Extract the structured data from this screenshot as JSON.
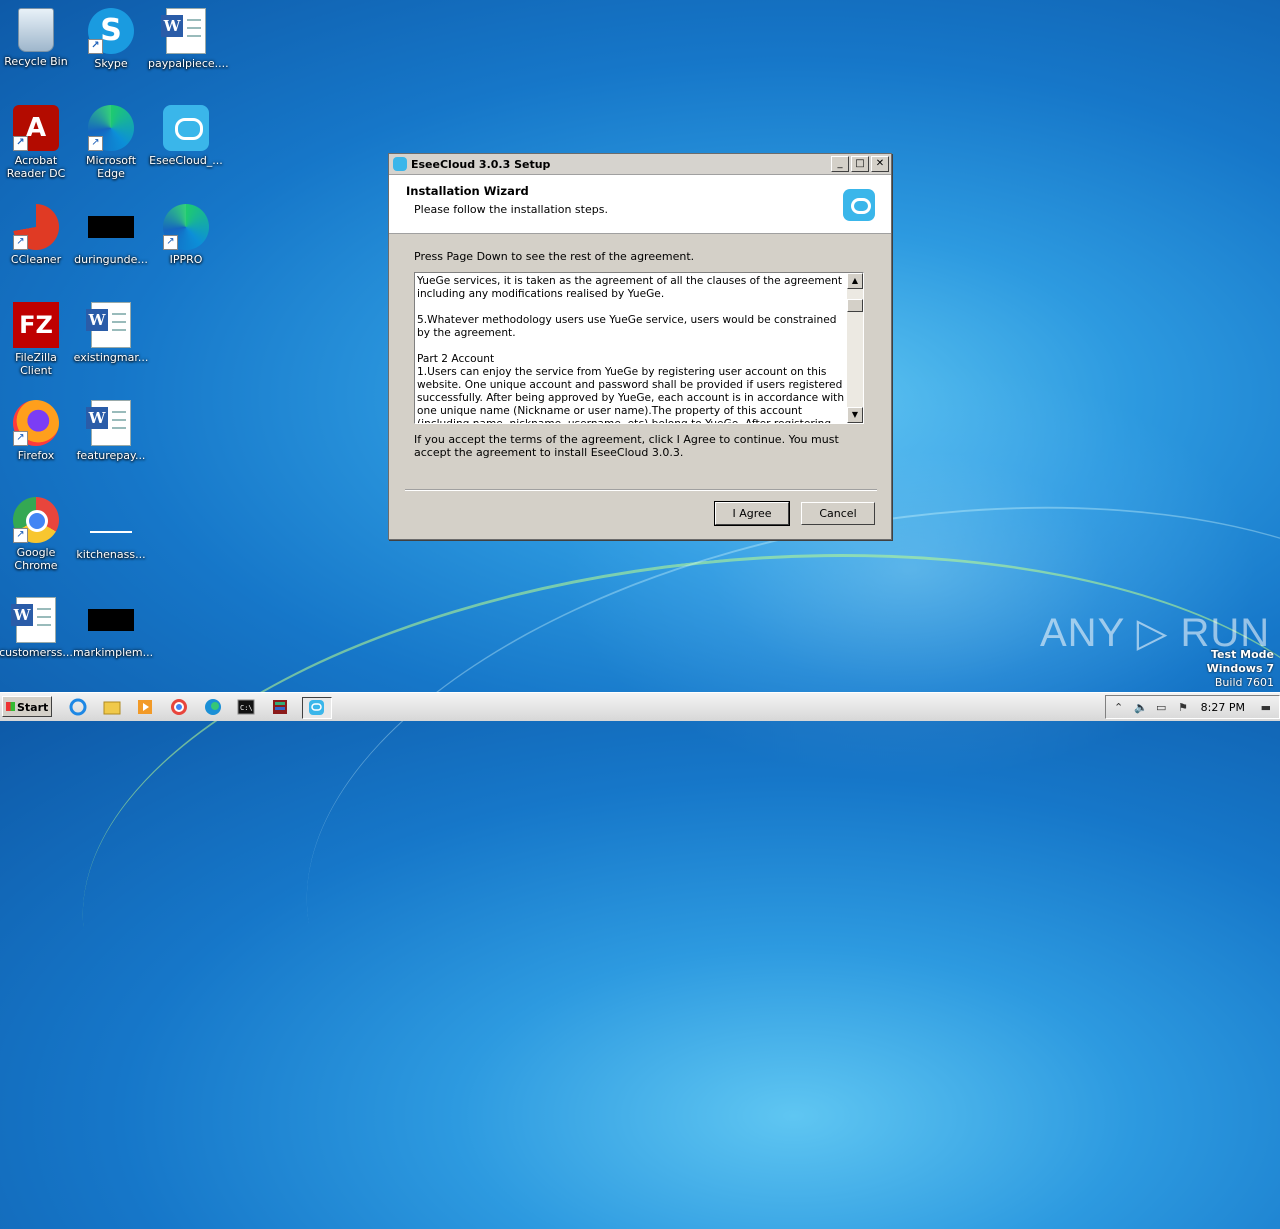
{
  "desktop": {
    "icons": [
      {
        "label": "Recycle Bin"
      },
      {
        "label": "Skype"
      },
      {
        "label": "paypalpiece...."
      },
      {
        "label": "Acrobat Reader DC"
      },
      {
        "label": "Microsoft Edge"
      },
      {
        "label": "EseeCloud_..."
      },
      {
        "label": "CCleaner"
      },
      {
        "label": "duringunde..."
      },
      {
        "label": "IPPRO"
      },
      {
        "label": "FileZilla Client"
      },
      {
        "label": "existingmar..."
      },
      {
        "label": "Firefox"
      },
      {
        "label": "featurepay..."
      },
      {
        "label": "Google Chrome"
      },
      {
        "label": "kitchenass..."
      },
      {
        "label": "customerss..."
      },
      {
        "label": "markimplem..."
      }
    ]
  },
  "window": {
    "title": "EseeCloud 3.0.3 Setup",
    "header_title": "Installation Wizard",
    "header_subtitle": "Please follow the installation steps.",
    "instruction": "Press Page Down to see the rest of the agreement.",
    "license_text": "YueGe services, it is taken as the agreement of all the clauses of the agreement including any modifications realised by YueGe.\n\n5.Whatever methodology users use YueGe service, users would be constrained by the agreement.\n\nPart 2 Account\n1.Users can enjoy the service from YueGe by registering user account on this website. One unique account and password shall be provided if users registered successfully. After being approved by YueGe, each account is in accordance with one unique name (Nickname or user name).The property of this account (including name, nickname, username, etc) belong to YueGe. After registering, users would be authorized to use this",
    "accept_note": "If you accept the terms of the agreement, click I Agree to continue. You must accept the agreement to install EseeCloud 3.0.3.",
    "agree_label": "I Agree",
    "cancel_label": "Cancel",
    "minimize_glyph": "_",
    "maximize_glyph": "□",
    "close_glyph": "✕"
  },
  "watermark": "ANY ▷ RUN",
  "test_mode": {
    "line1": "Test Mode",
    "line2": "Windows 7",
    "line3": "Build 7601"
  },
  "taskbar": {
    "start_label": "Start",
    "clock": "8:27 PM"
  }
}
